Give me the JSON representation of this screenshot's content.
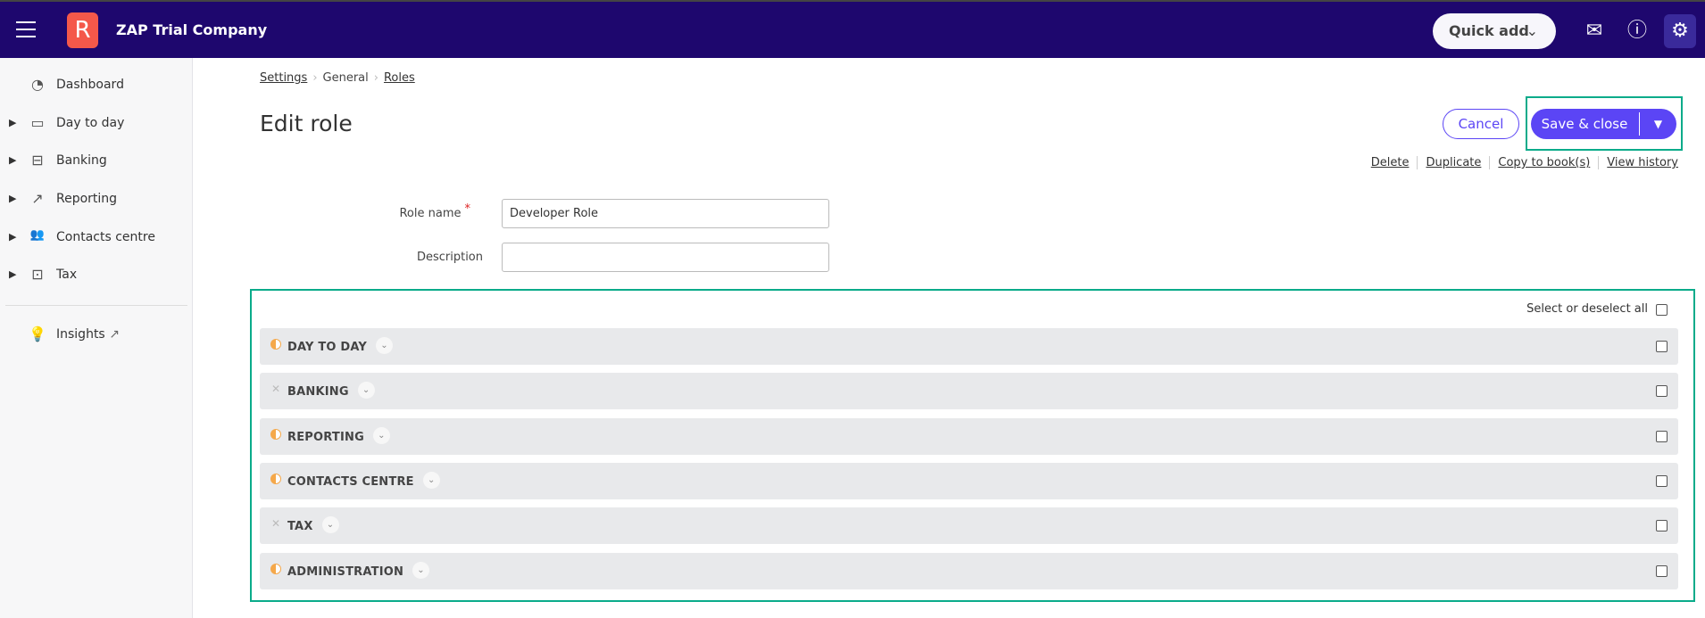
{
  "header": {
    "company": "ZAP Trial Company",
    "logo_letter": "R",
    "quick_add": "Quick add",
    "icons": [
      "menu-icon",
      "mail-icon",
      "help-icon",
      "gear-icon"
    ]
  },
  "sidebar": {
    "items": [
      {
        "label": "Dashboard",
        "icon": "pie-chart-icon",
        "icon_char": "◔",
        "expandable": false
      },
      {
        "label": "Day to day",
        "icon": "calendar-icon",
        "icon_char": "▭",
        "expandable": true
      },
      {
        "label": "Banking",
        "icon": "briefcase-icon",
        "icon_char": "⊟",
        "expandable": true
      },
      {
        "label": "Reporting",
        "icon": "trend-icon",
        "icon_char": "↗",
        "expandable": true
      },
      {
        "label": "Contacts centre",
        "icon": "people-icon",
        "icon_char": "👥",
        "expandable": true
      },
      {
        "label": "Tax",
        "icon": "archive-icon",
        "icon_char": "⊡",
        "expandable": true
      }
    ],
    "insights": "Insights"
  },
  "breadcrumb": [
    "Settings",
    "General",
    "Roles"
  ],
  "page": {
    "title": "Edit role",
    "cancel": "Cancel",
    "save": "Save & close",
    "links": [
      "Delete",
      "Duplicate",
      "Copy to book(s)",
      "View history"
    ]
  },
  "form": {
    "role_name_label": "Role name",
    "role_name_value": "Developer Role",
    "description_label": "Description",
    "description_value": ""
  },
  "permissions": {
    "select_all": "Select or deselect all",
    "select_all_checked": false,
    "sections": [
      {
        "name": "DAY TO DAY",
        "status": "partial",
        "checked": false
      },
      {
        "name": "BANKING",
        "status": "none",
        "checked": false
      },
      {
        "name": "REPORTING",
        "status": "partial",
        "checked": false
      },
      {
        "name": "CONTACTS CENTRE",
        "status": "partial",
        "checked": false
      },
      {
        "name": "TAX",
        "status": "none",
        "checked": false
      },
      {
        "name": "ADMINISTRATION",
        "status": "partial",
        "checked": false
      }
    ]
  },
  "colors": {
    "header": "#1e076e",
    "accent": "#5b45f5",
    "logo": "#f4584a",
    "highlight": "#0aab8a",
    "partial": "#f5a84a"
  }
}
